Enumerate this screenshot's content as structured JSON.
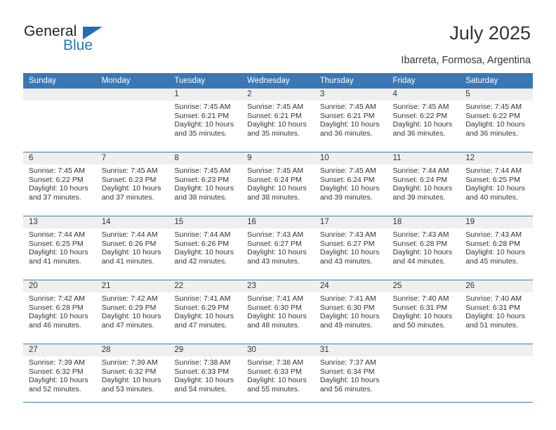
{
  "brand": {
    "name_part1": "General",
    "name_part2": "Blue",
    "triangle_icon": "triangle-icon",
    "accent_color": "#1f6fb8"
  },
  "header": {
    "title": "July 2025",
    "location": "Ibarreta, Formosa, Argentina"
  },
  "theme": {
    "header_blue": "#3b77b5",
    "band_gray": "#efefef",
    "text": "#333333"
  },
  "weekdays": [
    "Sunday",
    "Monday",
    "Tuesday",
    "Wednesday",
    "Thursday",
    "Friday",
    "Saturday"
  ],
  "weeks": [
    [
      {
        "day": "",
        "lines": []
      },
      {
        "day": "",
        "lines": []
      },
      {
        "day": "1",
        "lines": [
          "Sunrise: 7:45 AM",
          "Sunset: 6:21 PM",
          "Daylight: 10 hours",
          "and 35 minutes."
        ]
      },
      {
        "day": "2",
        "lines": [
          "Sunrise: 7:45 AM",
          "Sunset: 6:21 PM",
          "Daylight: 10 hours",
          "and 35 minutes."
        ]
      },
      {
        "day": "3",
        "lines": [
          "Sunrise: 7:45 AM",
          "Sunset: 6:21 PM",
          "Daylight: 10 hours",
          "and 36 minutes."
        ]
      },
      {
        "day": "4",
        "lines": [
          "Sunrise: 7:45 AM",
          "Sunset: 6:22 PM",
          "Daylight: 10 hours",
          "and 36 minutes."
        ]
      },
      {
        "day": "5",
        "lines": [
          "Sunrise: 7:45 AM",
          "Sunset: 6:22 PM",
          "Daylight: 10 hours",
          "and 36 minutes."
        ]
      }
    ],
    [
      {
        "day": "6",
        "lines": [
          "Sunrise: 7:45 AM",
          "Sunset: 6:22 PM",
          "Daylight: 10 hours",
          "and 37 minutes."
        ]
      },
      {
        "day": "7",
        "lines": [
          "Sunrise: 7:45 AM",
          "Sunset: 6:23 PM",
          "Daylight: 10 hours",
          "and 37 minutes."
        ]
      },
      {
        "day": "8",
        "lines": [
          "Sunrise: 7:45 AM",
          "Sunset: 6:23 PM",
          "Daylight: 10 hours",
          "and 38 minutes."
        ]
      },
      {
        "day": "9",
        "lines": [
          "Sunrise: 7:45 AM",
          "Sunset: 6:24 PM",
          "Daylight: 10 hours",
          "and 38 minutes."
        ]
      },
      {
        "day": "10",
        "lines": [
          "Sunrise: 7:45 AM",
          "Sunset: 6:24 PM",
          "Daylight: 10 hours",
          "and 39 minutes."
        ]
      },
      {
        "day": "11",
        "lines": [
          "Sunrise: 7:44 AM",
          "Sunset: 6:24 PM",
          "Daylight: 10 hours",
          "and 39 minutes."
        ]
      },
      {
        "day": "12",
        "lines": [
          "Sunrise: 7:44 AM",
          "Sunset: 6:25 PM",
          "Daylight: 10 hours",
          "and 40 minutes."
        ]
      }
    ],
    [
      {
        "day": "13",
        "lines": [
          "Sunrise: 7:44 AM",
          "Sunset: 6:25 PM",
          "Daylight: 10 hours",
          "and 41 minutes."
        ]
      },
      {
        "day": "14",
        "lines": [
          "Sunrise: 7:44 AM",
          "Sunset: 6:26 PM",
          "Daylight: 10 hours",
          "and 41 minutes."
        ]
      },
      {
        "day": "15",
        "lines": [
          "Sunrise: 7:44 AM",
          "Sunset: 6:26 PM",
          "Daylight: 10 hours",
          "and 42 minutes."
        ]
      },
      {
        "day": "16",
        "lines": [
          "Sunrise: 7:43 AM",
          "Sunset: 6:27 PM",
          "Daylight: 10 hours",
          "and 43 minutes."
        ]
      },
      {
        "day": "17",
        "lines": [
          "Sunrise: 7:43 AM",
          "Sunset: 6:27 PM",
          "Daylight: 10 hours",
          "and 43 minutes."
        ]
      },
      {
        "day": "18",
        "lines": [
          "Sunrise: 7:43 AM",
          "Sunset: 6:28 PM",
          "Daylight: 10 hours",
          "and 44 minutes."
        ]
      },
      {
        "day": "19",
        "lines": [
          "Sunrise: 7:43 AM",
          "Sunset: 6:28 PM",
          "Daylight: 10 hours",
          "and 45 minutes."
        ]
      }
    ],
    [
      {
        "day": "20",
        "lines": [
          "Sunrise: 7:42 AM",
          "Sunset: 6:28 PM",
          "Daylight: 10 hours",
          "and 46 minutes."
        ]
      },
      {
        "day": "21",
        "lines": [
          "Sunrise: 7:42 AM",
          "Sunset: 6:29 PM",
          "Daylight: 10 hours",
          "and 47 minutes."
        ]
      },
      {
        "day": "22",
        "lines": [
          "Sunrise: 7:41 AM",
          "Sunset: 6:29 PM",
          "Daylight: 10 hours",
          "and 47 minutes."
        ]
      },
      {
        "day": "23",
        "lines": [
          "Sunrise: 7:41 AM",
          "Sunset: 6:30 PM",
          "Daylight: 10 hours",
          "and 48 minutes."
        ]
      },
      {
        "day": "24",
        "lines": [
          "Sunrise: 7:41 AM",
          "Sunset: 6:30 PM",
          "Daylight: 10 hours",
          "and 49 minutes."
        ]
      },
      {
        "day": "25",
        "lines": [
          "Sunrise: 7:40 AM",
          "Sunset: 6:31 PM",
          "Daylight: 10 hours",
          "and 50 minutes."
        ]
      },
      {
        "day": "26",
        "lines": [
          "Sunrise: 7:40 AM",
          "Sunset: 6:31 PM",
          "Daylight: 10 hours",
          "and 51 minutes."
        ]
      }
    ],
    [
      {
        "day": "27",
        "lines": [
          "Sunrise: 7:39 AM",
          "Sunset: 6:32 PM",
          "Daylight: 10 hours",
          "and 52 minutes."
        ]
      },
      {
        "day": "28",
        "lines": [
          "Sunrise: 7:39 AM",
          "Sunset: 6:32 PM",
          "Daylight: 10 hours",
          "and 53 minutes."
        ]
      },
      {
        "day": "29",
        "lines": [
          "Sunrise: 7:38 AM",
          "Sunset: 6:33 PM",
          "Daylight: 10 hours",
          "and 54 minutes."
        ]
      },
      {
        "day": "30",
        "lines": [
          "Sunrise: 7:38 AM",
          "Sunset: 6:33 PM",
          "Daylight: 10 hours",
          "and 55 minutes."
        ]
      },
      {
        "day": "31",
        "lines": [
          "Sunrise: 7:37 AM",
          "Sunset: 6:34 PM",
          "Daylight: 10 hours",
          "and 56 minutes."
        ]
      },
      {
        "day": "",
        "lines": []
      },
      {
        "day": "",
        "lines": []
      }
    ]
  ]
}
